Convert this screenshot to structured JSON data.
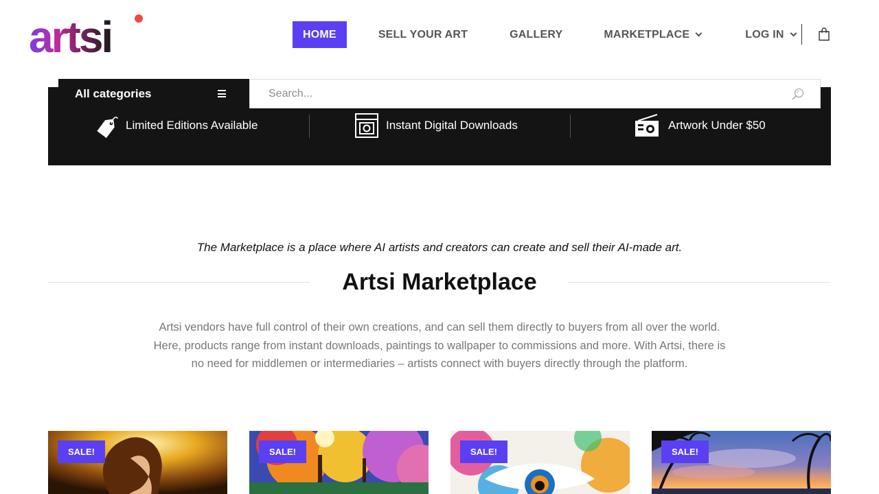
{
  "brand": {
    "logo_text": "artsi",
    "colors": {
      "accent": "#5b3ff2",
      "logo_pink": "#e0308a",
      "logo_dot": "#f04040",
      "dark": "#141414"
    }
  },
  "nav": {
    "items": [
      {
        "label": "HOME",
        "active": true,
        "has_dropdown": false
      },
      {
        "label": "SELL YOUR ART",
        "active": false,
        "has_dropdown": false
      },
      {
        "label": "GALLERY",
        "active": false,
        "has_dropdown": false
      },
      {
        "label": "MARKETPLACE",
        "active": false,
        "has_dropdown": true
      },
      {
        "label": "LOG IN",
        "active": false,
        "has_dropdown": true
      }
    ],
    "cart_icon": "shopping-bag-icon"
  },
  "search_bar": {
    "categories_label": "All categories",
    "categories_icon": "menu-icon",
    "placeholder": "Search...",
    "search_icon": "search-icon"
  },
  "features": [
    {
      "icon": "price-tag-icon",
      "label": "Limited Editions Available"
    },
    {
      "icon": "download-box-icon",
      "label": "Instant Digital Downloads"
    },
    {
      "icon": "radio-icon",
      "label": "Artwork Under $50"
    }
  ],
  "content": {
    "tagline": "The Marketplace is a place where AI artists and creators can create and sell their AI-made art.",
    "title": "Artsi Marketplace",
    "description": "Artsi vendors have full control of their own creations, and can sell them directly to buyers from all over the world. Here, products range from instant downloads, paintings to wallpaper to commissions and more. With Artsi, there is no need for middlemen or intermediaries – artists connect with buyers directly through the platform."
  },
  "products": [
    {
      "badge": "SALE!",
      "image": "golden-woman-portrait"
    },
    {
      "badge": "SALE!",
      "image": "colorful-forest"
    },
    {
      "badge": "SALE!",
      "image": "colorful-eye"
    },
    {
      "badge": "SALE!",
      "image": "tropical-sunset"
    }
  ]
}
